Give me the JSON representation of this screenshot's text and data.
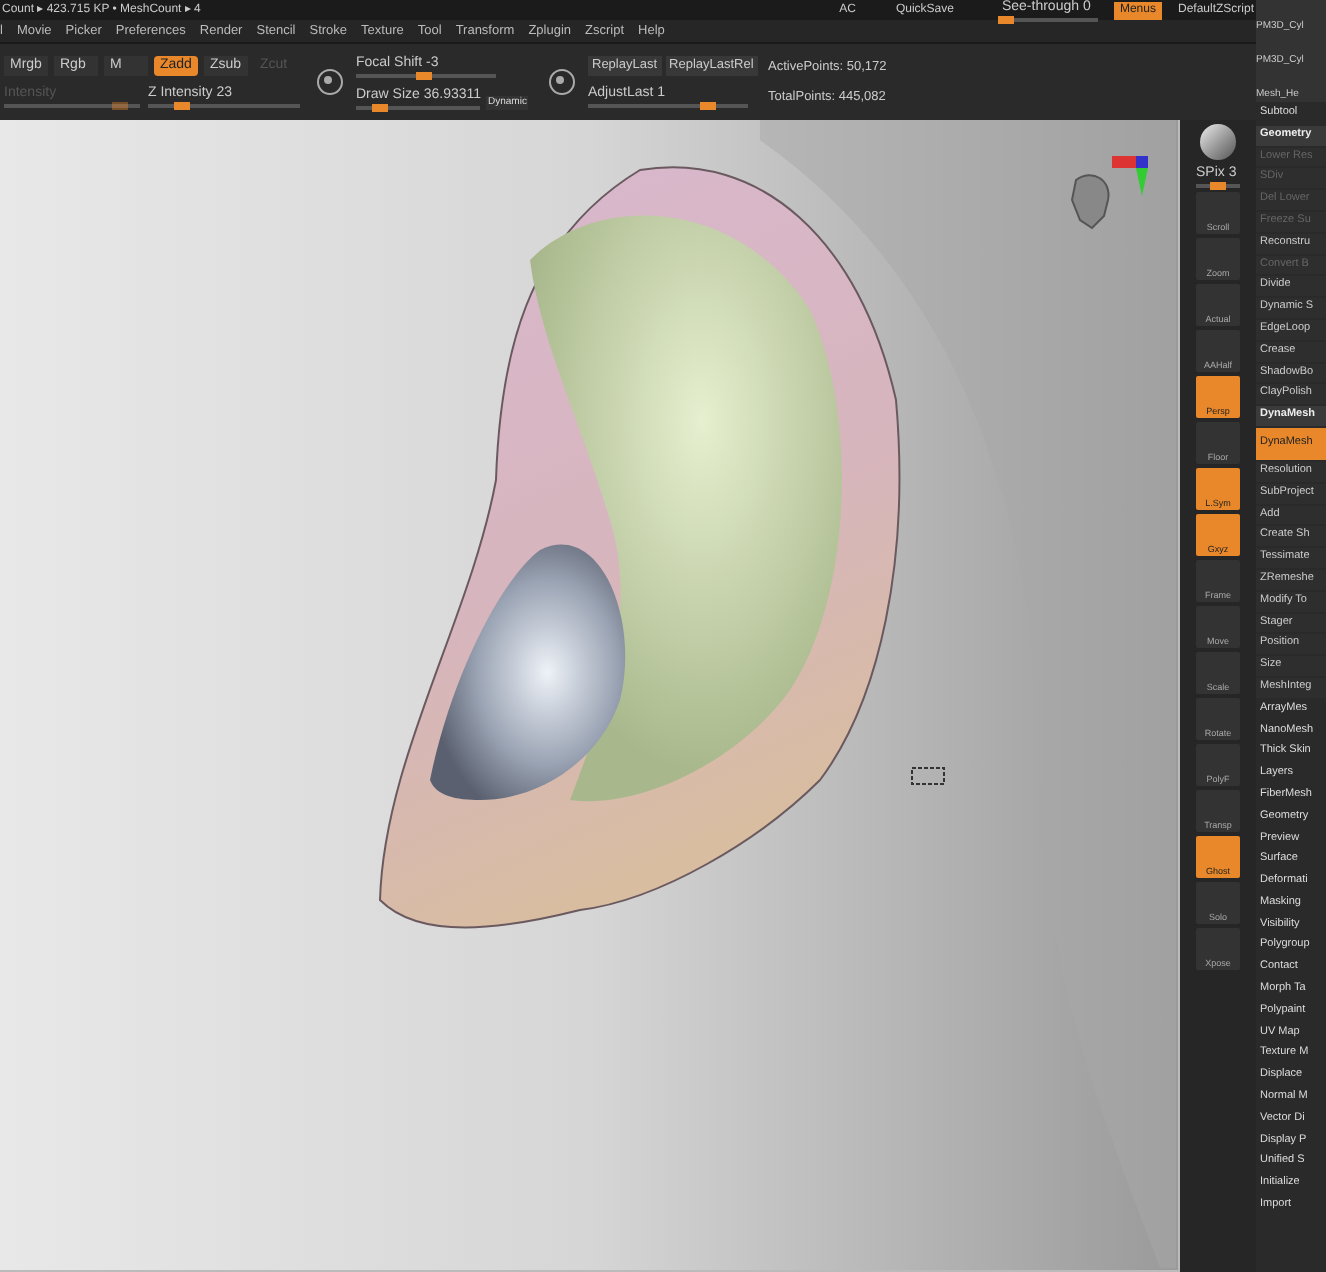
{
  "status": {
    "counts": "Count ▸ 423.715 KP  • MeshCount ▸ 4",
    "ac": "AC",
    "quicksave": "QuickSave",
    "see_through": {
      "label": "See-through  0",
      "level": 0.05
    },
    "menus": {
      "label": "Menus",
      "on": true
    },
    "script": "DefaultZScript"
  },
  "menu_bar": [
    "l",
    "Movie",
    "Picker",
    "Preferences",
    "Render",
    "Stencil",
    "Stroke",
    "Texture",
    "Tool",
    "Transform",
    "Zplugin",
    "Zscript",
    "Help"
  ],
  "toolbar": {
    "modes": [
      {
        "label": "Mrgb",
        "selected": false,
        "disabled": false
      },
      {
        "label": "Rgb",
        "selected": false,
        "disabled": false
      },
      {
        "label": "M",
        "selected": false,
        "disabled": false
      },
      {
        "label": "Zadd",
        "selected": true,
        "disabled": false
      },
      {
        "label": "Zsub",
        "selected": false,
        "disabled": false
      },
      {
        "label": "Zcut",
        "selected": false,
        "disabled": true
      }
    ],
    "intensity": {
      "label": "Intensity",
      "level": 0.85,
      "disabled": true
    },
    "z_intensity": {
      "label": "Z Intensity 23",
      "level": 0.23
    },
    "focal_shift": {
      "label": "Focal Shift -3",
      "level": 0.48
    },
    "draw_size": {
      "label": "Draw Size 36.93311",
      "level": 0.2
    },
    "dynamic": "Dynamic",
    "replay": [
      "ReplayLast",
      "ReplayLastRel"
    ],
    "adjust_last": {
      "label": "AdjustLast 1",
      "level": 0.75
    },
    "stats": [
      "ActivePoints: 50,172",
      "TotalPoints: 445,082"
    ]
  },
  "tool_thumbs": [
    "PM3D_Cyl",
    "PM3D_Cyl",
    "Mesh_He"
  ],
  "spix": {
    "label": "SPix 3",
    "level": 0.5
  },
  "shelf": [
    {
      "label": "Scroll",
      "selected": false
    },
    {
      "label": "Zoom",
      "selected": false
    },
    {
      "label": "Actual",
      "selected": false
    },
    {
      "label": "AAHalf",
      "selected": false
    },
    {
      "label": "Persp",
      "selected": true
    },
    {
      "label": "Floor",
      "selected": false
    },
    {
      "label": "L.Sym",
      "selected": true
    },
    {
      "label": "Gxyz",
      "selected": true
    },
    {
      "label": "Frame",
      "selected": false
    },
    {
      "label": "Move",
      "selected": false
    },
    {
      "label": "Scale",
      "selected": false
    },
    {
      "label": "Rotate",
      "selected": false
    },
    {
      "label": "PolyF",
      "selected": false
    },
    {
      "label": "Transp",
      "selected": false
    },
    {
      "label": "Ghost",
      "selected": true
    },
    {
      "label": "Solo",
      "selected": false
    },
    {
      "label": "Xpose",
      "selected": false
    }
  ],
  "panel": [
    {
      "label": "Subtool",
      "kind": "section"
    },
    {
      "label": "Geometry",
      "kind": "header"
    },
    {
      "label": "Lower Res",
      "kind": "disabled"
    },
    {
      "label": "SDiv",
      "kind": "disabled"
    },
    {
      "label": "Del Lower",
      "kind": "disabled"
    },
    {
      "label": "Freeze Su",
      "kind": "disabled"
    },
    {
      "label": "Reconstru",
      "kind": "item"
    },
    {
      "label": "Convert B",
      "kind": "disabled"
    },
    {
      "label": "Divide",
      "kind": "item"
    },
    {
      "label": "Dynamic S",
      "kind": "item"
    },
    {
      "label": "EdgeLoop",
      "kind": "item"
    },
    {
      "label": "Crease",
      "kind": "item"
    },
    {
      "label": "ShadowBo",
      "kind": "item"
    },
    {
      "label": "ClayPolish",
      "kind": "item"
    },
    {
      "label": "DynaMesh",
      "kind": "header"
    },
    {
      "label": "DynaMesh",
      "kind": "active"
    },
    {
      "label": "Resolution",
      "kind": "item"
    },
    {
      "label": "SubProject",
      "kind": "item"
    },
    {
      "label": "Add",
      "kind": "item"
    },
    {
      "label": "Create Sh",
      "kind": "item"
    },
    {
      "label": "Tessimate",
      "kind": "item"
    },
    {
      "label": "ZRemeshe",
      "kind": "item"
    },
    {
      "label": "Modify To",
      "kind": "item"
    },
    {
      "label": "Stager",
      "kind": "item"
    },
    {
      "label": "Position",
      "kind": "item"
    },
    {
      "label": "Size",
      "kind": "item"
    },
    {
      "label": "MeshInteg",
      "kind": "item"
    },
    {
      "label": "ArrayMes",
      "kind": "section"
    },
    {
      "label": "NanoMesh",
      "kind": "section"
    },
    {
      "label": "Thick Skin",
      "kind": "section"
    },
    {
      "label": "Layers",
      "kind": "section"
    },
    {
      "label": "FiberMesh",
      "kind": "section"
    },
    {
      "label": "Geometry",
      "kind": "section"
    },
    {
      "label": "Preview",
      "kind": "section"
    },
    {
      "label": "Surface",
      "kind": "section"
    },
    {
      "label": "Deformati",
      "kind": "section"
    },
    {
      "label": "Masking",
      "kind": "section"
    },
    {
      "label": "Visibility",
      "kind": "section"
    },
    {
      "label": "Polygroup",
      "kind": "section"
    },
    {
      "label": "Contact",
      "kind": "section"
    },
    {
      "label": "Morph Ta",
      "kind": "section"
    },
    {
      "label": "Polypaint",
      "kind": "section"
    },
    {
      "label": "UV Map",
      "kind": "section"
    },
    {
      "label": "Texture M",
      "kind": "section"
    },
    {
      "label": "Displace",
      "kind": "section"
    },
    {
      "label": "Normal M",
      "kind": "section"
    },
    {
      "label": "Vector Di",
      "kind": "section"
    },
    {
      "label": "Display P",
      "kind": "section"
    },
    {
      "label": "Unified S",
      "kind": "section"
    },
    {
      "label": "Initialize",
      "kind": "section"
    },
    {
      "label": "Import",
      "kind": "section"
    }
  ]
}
